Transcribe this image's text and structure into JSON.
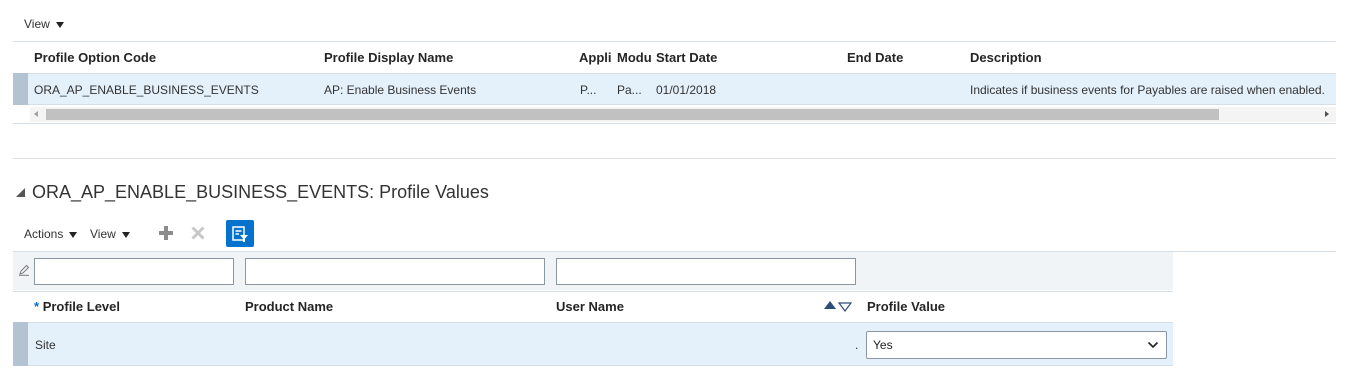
{
  "top_toolbar": {
    "view_label": "View"
  },
  "profile_table": {
    "columns": [
      "Profile Option Code",
      "Profile Display Name",
      "Appli",
      "Modu",
      "Start Date",
      "End Date",
      "Description"
    ],
    "row": {
      "code": "ORA_AP_ENABLE_BUSINESS_EVENTS",
      "display_name": "AP: Enable Business Events",
      "application": "P...",
      "module": "Pa...",
      "start_date": "01/01/2018",
      "end_date": "",
      "description": "Indicates if business events for Payables are raised when enabled."
    }
  },
  "values_section": {
    "title": "ORA_AP_ENABLE_BUSINESS_EVENTS: Profile Values",
    "toolbar": {
      "actions_label": "Actions",
      "view_label": "View",
      "add_icon": "plus-icon",
      "delete_icon": "x-icon",
      "filter_icon": "query-by-example-icon"
    },
    "filters": {
      "profile_level": "",
      "product_name": "",
      "user_name": ""
    },
    "columns": {
      "required_mark": "*",
      "profile_level": "Profile Level",
      "product_name": "Product Name",
      "user_name": "User Name",
      "profile_value": "Profile Value"
    },
    "row": {
      "profile_level": "Site",
      "product_name": "",
      "user_name": ".",
      "profile_value": "Yes"
    }
  },
  "colors": {
    "accent": "#0572ce",
    "selected_row": "#e4f0fa",
    "row_marker": "#b3c3d1"
  }
}
